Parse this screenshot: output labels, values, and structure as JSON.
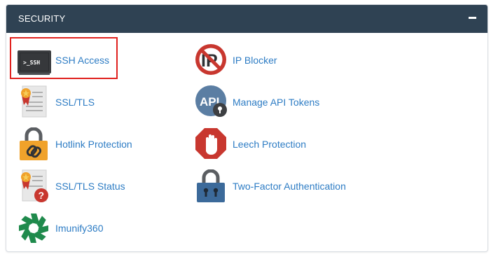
{
  "section": {
    "title": "SECURITY",
    "collapse_icon": "minus-icon"
  },
  "items": [
    {
      "label": "SSH Access",
      "icon": "ssh-terminal-icon",
      "highlighted": true
    },
    {
      "label": "IP Blocker",
      "icon": "ip-blocker-icon"
    },
    {
      "label": "SSL/TLS",
      "icon": "certificate-icon"
    },
    {
      "label": "Manage API Tokens",
      "icon": "api-tokens-icon"
    },
    {
      "label": "Hotlink Protection",
      "icon": "hotlink-lock-icon"
    },
    {
      "label": "Leech Protection",
      "icon": "leech-stop-hand-icon"
    },
    {
      "label": "SSL/TLS Status",
      "icon": "certificate-status-icon"
    },
    {
      "label": "Two-Factor Authentication",
      "icon": "two-factor-lock-icon"
    },
    {
      "label": "Imunify360",
      "icon": "imunify360-logo-icon"
    }
  ],
  "colors": {
    "header_bg": "#2f4253",
    "link": "#2d7cc4",
    "highlight_border": "#e0211e"
  }
}
